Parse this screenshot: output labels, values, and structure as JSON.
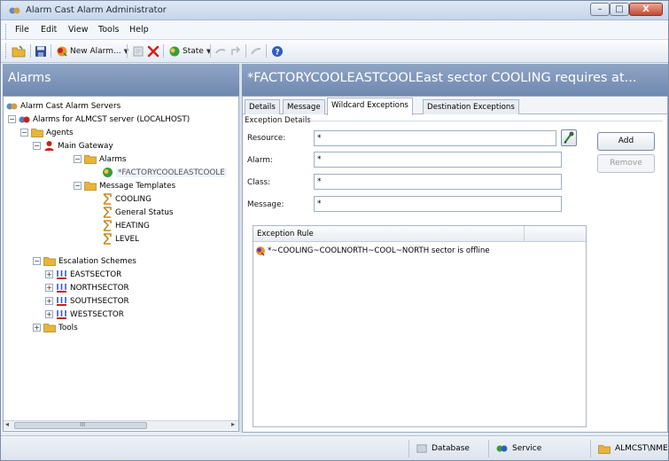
{
  "window": {
    "title": "Alarm Cast Alarm Administrator",
    "min_glyph": "–",
    "max_glyph": "□",
    "close_glyph": "X"
  },
  "menu": [
    "File",
    "Edit",
    "View",
    "Tools",
    "Help"
  ],
  "toolbar": {
    "new_alarm_label": "New Alarm...",
    "state_label": "State"
  },
  "left_pane": {
    "title": "Alarms"
  },
  "tree": {
    "root": "Alarm Cast Alarm Servers",
    "server": "Alarms for ALMCST server (LOCALHOST)",
    "agents": "Agents",
    "main_gateway": "Main Gateway",
    "alarms": "Alarms",
    "selected_alarm": "*FACTORYCOOLEASTCOOLE",
    "message_templates": "Message Templates",
    "templates": [
      "COOLING",
      "General Status",
      "HEATING",
      "LEVEL"
    ],
    "escalation_schemes": "Escalation Schemes",
    "schemes": [
      "EASTSECTOR",
      "NORTHSECTOR",
      "SOUTHSECTOR",
      "WESTSECTOR"
    ],
    "tools": "Tools",
    "scroll_grip": "III",
    "scroll_left": "◂",
    "scroll_right": "▸"
  },
  "right_pane": {
    "title": "*FACTORYCOOLEASTCOOLEast sector COOLING requires at..."
  },
  "tabs": [
    "Details",
    "Message",
    "Wildcard Exceptions",
    "Destination Exceptions"
  ],
  "active_tab": "Wildcard Exceptions",
  "exception_details": {
    "group_title": "Exception Details",
    "resource_label": "Resource:",
    "resource_value": "*",
    "alarm_label": "Alarm:",
    "alarm_value": "*",
    "class_label": "Class:",
    "class_value": "*",
    "message_label": "Message:",
    "message_value": "*",
    "add_label": "Add",
    "remove_label": "Remove"
  },
  "rule_list": {
    "column": "Exception Rule",
    "rows": [
      "*~COOLING~COOLNORTH~COOL~NORTH sector is offline"
    ]
  },
  "statusbar": {
    "database": "Database",
    "service": "Service",
    "user": "ALMCST\\NME"
  },
  "colors": {
    "pane_header": "#7a91b6",
    "folder": "#e8b53a",
    "accent_red": "#c8201d"
  }
}
